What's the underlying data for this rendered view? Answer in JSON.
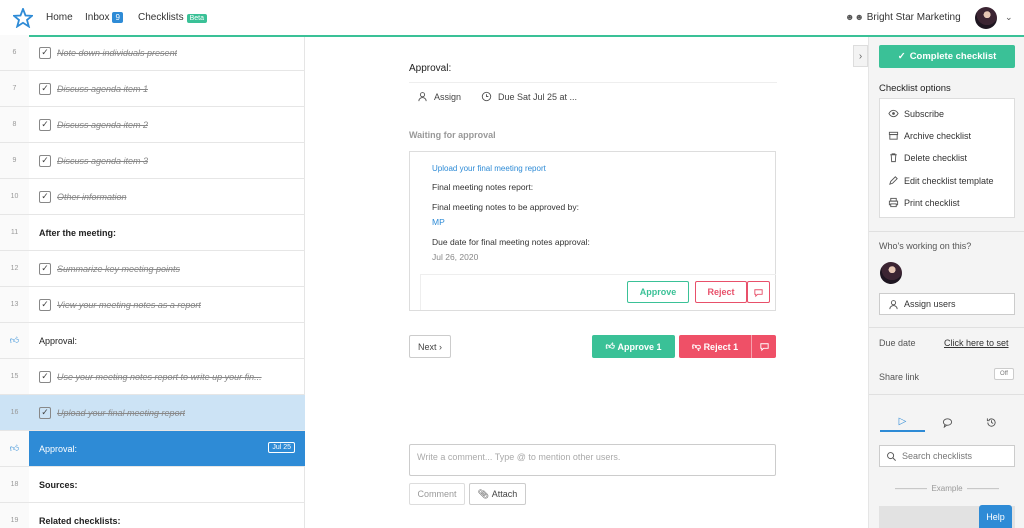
{
  "nav": {
    "home": "Home",
    "inbox": "Inbox",
    "inbox_count": "9",
    "checklists": "Checklists",
    "beta": "Beta",
    "org": "Bright Star Marketing"
  },
  "tasks": [
    {
      "num": "6",
      "label": "Note down individuals present",
      "kind": "done"
    },
    {
      "num": "7",
      "label": "Discuss agenda item 1",
      "kind": "done"
    },
    {
      "num": "8",
      "label": "Discuss agenda item 2",
      "kind": "done"
    },
    {
      "num": "9",
      "label": "Discuss agenda item 3",
      "kind": "done"
    },
    {
      "num": "10",
      "label": "Other information",
      "kind": "done"
    },
    {
      "num": "11",
      "label": "After the meeting:",
      "kind": "header"
    },
    {
      "num": "12",
      "label": "Summarize key meeting points",
      "kind": "done"
    },
    {
      "num": "13",
      "label": "View your meeting notes as a report",
      "kind": "done"
    },
    {
      "num": "",
      "label": "Approval:",
      "kind": "approval"
    },
    {
      "num": "15",
      "label": "Use your meeting notes report to write up your fin...",
      "kind": "done"
    },
    {
      "num": "16",
      "label": "Upload your final meeting report",
      "kind": "done-selected"
    },
    {
      "num": "",
      "label": "Approval:",
      "kind": "approval-active",
      "tag": "Jul 25"
    },
    {
      "num": "18",
      "label": "Sources:",
      "kind": "header"
    },
    {
      "num": "19",
      "label": "Related checklists:",
      "kind": "header"
    }
  ],
  "center": {
    "title": "Approval:",
    "assign": "Assign",
    "due": "Due Sat Jul 25 at ...",
    "waiting": "Waiting for approval",
    "box": {
      "link": "Upload your final meeting report",
      "field1": "Final meeting notes report:",
      "field2": "Final meeting notes to be approved by:",
      "field2_value": "MP",
      "field3": "Due date for final meeting notes approval:",
      "field3_value": "Jul 26, 2020",
      "approve": "Approve",
      "reject": "Reject"
    },
    "next": "Next",
    "approve_1": "Approve 1",
    "reject_1": "Reject 1",
    "comment_placeholder": "Write a comment... Type @ to mention other users.",
    "comment_btn": "Comment",
    "attach_btn": "Attach"
  },
  "sidebar": {
    "complete": "Complete checklist",
    "options_title": "Checklist options",
    "options": [
      "Subscribe",
      "Archive checklist",
      "Delete checklist",
      "Edit checklist template",
      "Print checklist"
    ],
    "working": "Who's working on this?",
    "assign_users": "Assign users",
    "due_date": "Due date",
    "due_link": "Click here to set",
    "share_link": "Share link",
    "toggle": "Off",
    "search_placeholder": "Search checklists",
    "example": "Example",
    "help": "Help"
  },
  "colors": {
    "accent_green": "#3ac197",
    "accent_blue": "#2e8bd6",
    "reject_red": "#ef5067"
  }
}
